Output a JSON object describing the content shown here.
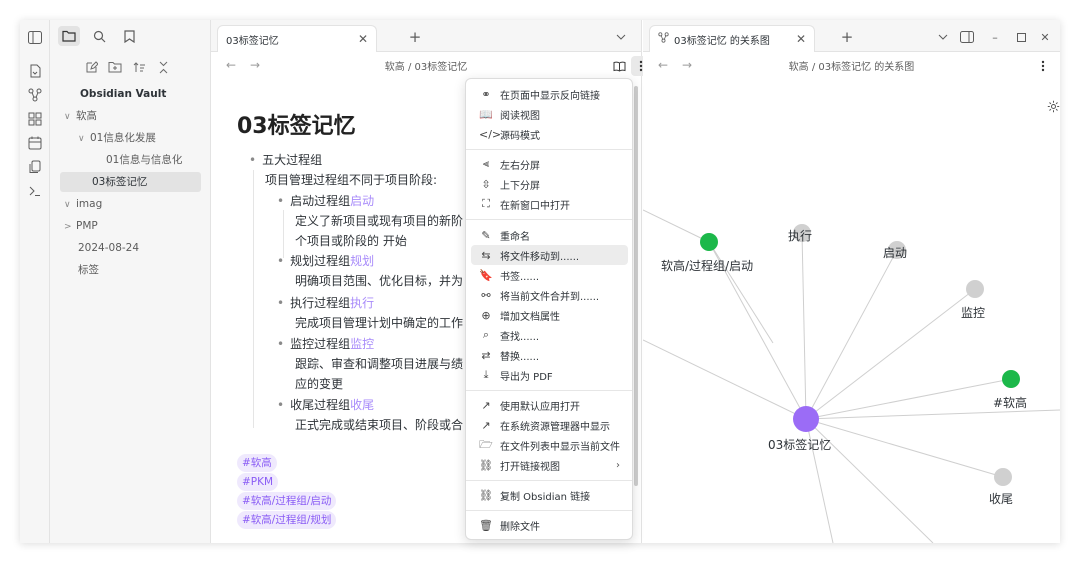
{
  "ribbon": {
    "icons": [
      "sidebar-toggle-icon",
      "quick-switcher-icon",
      "graph-icon",
      "canvas-icon",
      "calendar-icon",
      "pages-icon",
      "terminal-icon"
    ]
  },
  "sidebar": {
    "tabs": [
      "files-tab",
      "search-tab",
      "bookmarks-tab"
    ],
    "vault_name": "Obsidian Vault",
    "tree": [
      {
        "label": "软高",
        "arrow": "∨"
      },
      {
        "label": "01信息化发展",
        "arrow": "∨"
      },
      {
        "label": "01信息与信息化",
        "arrow": ""
      },
      {
        "label": "03标签记忆",
        "arrow": ""
      },
      {
        "label": "imag",
        "arrow": "∨"
      },
      {
        "label": "PMP",
        "arrow": ">"
      },
      {
        "label": "2024-08-24",
        "arrow": ""
      },
      {
        "label": "标签",
        "arrow": ""
      }
    ]
  },
  "center": {
    "tab_label": "03标签记忆",
    "breadcrumb": "软高 / 03标签记忆",
    "title": "03标签记忆",
    "lines": {
      "l1": "五大过程组",
      "l2": "项目管理过程组不同于项目阶段:",
      "l3a": "启动过程组",
      "l3b": "启动",
      "l4": "定义了新项目或现有项目的新阶",
      "l5": "个项目或阶段的 开始",
      "l6a": "规划过程组",
      "l6b": "规划",
      "l7": "明确项目范围、优化目标，并为",
      "l8a": "执行过程组",
      "l8b": "执行",
      "l9": "完成项目管理计划中确定的工作",
      "l10a": "监控过程组",
      "l10b": "监控",
      "l11": "跟踪、审查和调整项目进展与绩",
      "l12": "应的变更",
      "l13a": "收尾过程组",
      "l13b": "收尾",
      "l14": "正式完成或结束项目、阶段或合"
    },
    "tags": [
      "#软高",
      "#PKM",
      "#软高/过程组/启动",
      "#软高/过程组/规划"
    ]
  },
  "menu": {
    "items": [
      {
        "icon": "⚭",
        "label": "在页面中显示反向链接"
      },
      {
        "icon": "📖",
        "label": "阅读视图"
      },
      {
        "icon": "</>",
        "label": "源码模式"
      },
      {
        "icon": "⫷",
        "label": "左右分屏"
      },
      {
        "icon": "⇳",
        "label": "上下分屏"
      },
      {
        "icon": "⛶",
        "label": "在新窗口中打开"
      },
      {
        "icon": "✎",
        "label": "重命名"
      },
      {
        "icon": "⇆",
        "label": "将文件移动到......"
      },
      {
        "icon": "🔖",
        "label": "书签......"
      },
      {
        "icon": "⚯",
        "label": "将当前文件合并到......"
      },
      {
        "icon": "⊕",
        "label": "增加文档属性"
      },
      {
        "icon": "⌕",
        "label": "查找......"
      },
      {
        "icon": "⇄",
        "label": "替换......"
      },
      {
        "icon": "⤓",
        "label": "导出为 PDF"
      },
      {
        "icon": "↗",
        "label": "使用默认应用打开"
      },
      {
        "icon": "↗",
        "label": "在系统资源管理器中显示"
      },
      {
        "icon": "🗁",
        "label": "在文件列表中显示当前文件"
      },
      {
        "icon": "⛓",
        "label": "打开链接视图"
      },
      {
        "icon": "⛓",
        "label": "复制 Obsidian 链接"
      },
      {
        "icon": "🗑",
        "label": "删除文件"
      }
    ]
  },
  "right": {
    "tab_label": "03标签记忆 的关系图",
    "breadcrumb": "软高 / 03标签记忆 的关系图",
    "nodes": {
      "center": "03标签记忆",
      "execute": "执行",
      "start": "启动",
      "monitor": "监控",
      "ruangao": "#软高",
      "close": "收尾",
      "start_tag": "软高/过程组/启动"
    }
  },
  "colors": {
    "accent": "#9b6cf6",
    "tag_bg": "#efe9fd",
    "node_green": "#1cb84a",
    "node_grey": "#d0d0d0"
  }
}
